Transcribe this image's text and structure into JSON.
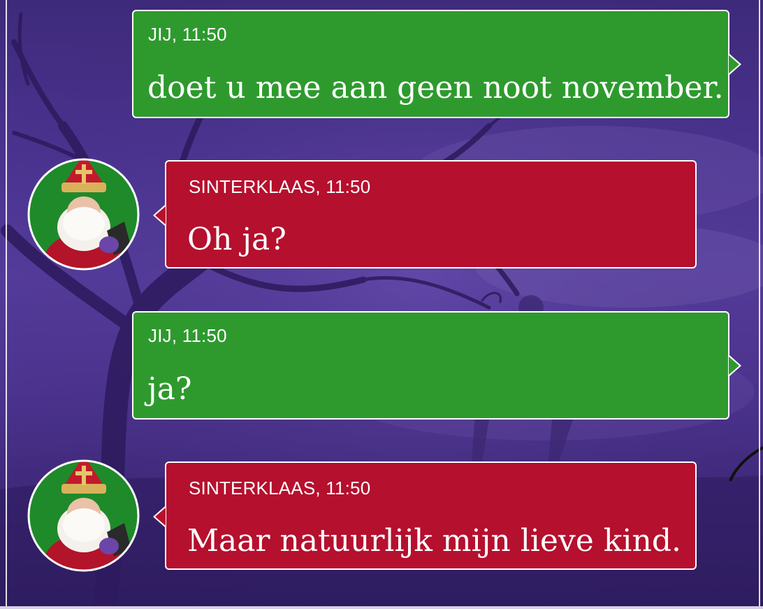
{
  "messages": [
    {
      "sender": "JIJ, 11:50",
      "text": "doet u mee aan geen noot november."
    },
    {
      "sender": "SINTERKLAAS, 11:50",
      "text": "Oh ja?",
      "avatar": "sinterklaas-avatar"
    },
    {
      "sender": "JIJ, 11:50",
      "text": "ja?"
    },
    {
      "sender": "SINTERKLAAS, 11:50",
      "text": "Maar natuurlijk mijn lieve kind.",
      "avatar": "sinterklaas-avatar"
    }
  ],
  "colors": {
    "user_bubble": "#2e9a2e",
    "bot_bubble": "#b5102e",
    "background": "#4a3390",
    "border": "#ffffff"
  }
}
